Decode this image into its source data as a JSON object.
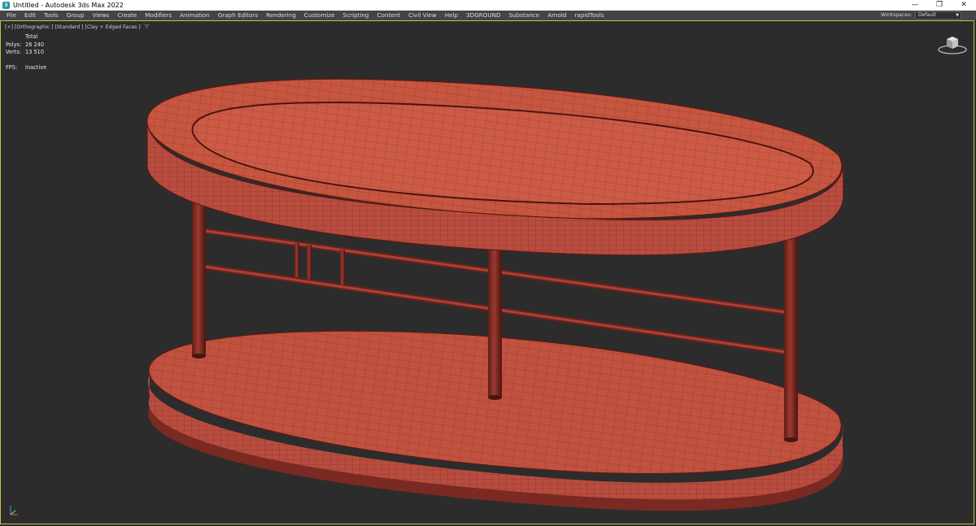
{
  "window": {
    "title": "Untitled - Autodesk 3ds Max 2022",
    "logo_glyph": "3",
    "controls": [
      "—",
      "❐",
      "✕"
    ]
  },
  "menu": {
    "items": [
      "File",
      "Edit",
      "Tools",
      "Group",
      "Views",
      "Create",
      "Modifiers",
      "Animation",
      "Graph Editors",
      "Rendering",
      "Customize",
      "Scripting",
      "Content",
      "Civil View",
      "Help",
      "3DGROUND",
      "Substance",
      "Arnold",
      "rapidTools"
    ],
    "workspace_label": "Workspaces:",
    "workspace_value": "Default"
  },
  "viewport": {
    "labels": [
      "[+]",
      "[Orthographic ]",
      "[Standard ]",
      "[Clay + Edged Faces ]"
    ],
    "filter_icon": "filter-icon",
    "stats": {
      "header": "Total",
      "polys_label": "Polys:",
      "polys_value": "26 240",
      "verts_label": "Verts:",
      "verts_value": "13 510",
      "fps_label": "FPS:",
      "fps_value": "Inactive"
    }
  },
  "colors": {
    "model_fill": "#b84d3f",
    "model_fill_light": "#c9594a",
    "edge_color": "#5a1a14",
    "viewport_bg": "#2c2c2c",
    "active_border": "#c7c04d",
    "menubar_bg": "#444444"
  }
}
